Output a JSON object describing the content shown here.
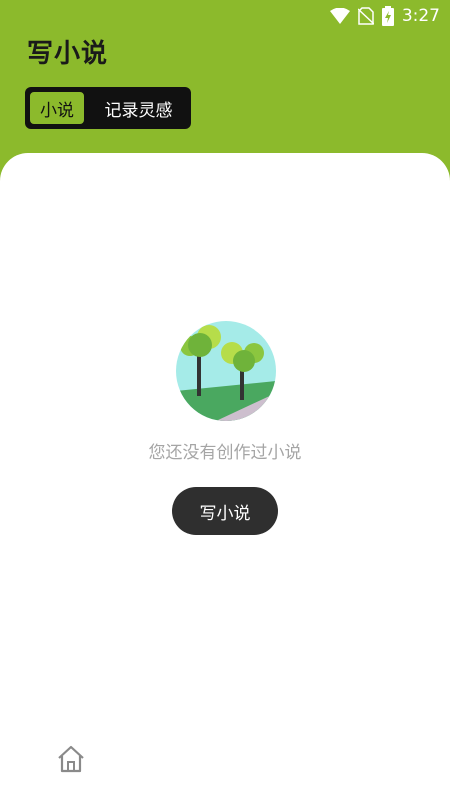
{
  "status_bar": {
    "time": "3:27",
    "icons": [
      "wifi-icon",
      "no-sim-icon",
      "battery-charging-icon"
    ]
  },
  "header": {
    "title": "写小说",
    "tabs": [
      {
        "label": "小说",
        "active": true
      },
      {
        "label": "记录灵感",
        "active": false
      }
    ],
    "accent_color": "#8cba2c"
  },
  "main": {
    "empty_illustration": "trees-illustration-icon",
    "empty_message": "您还没有创作过小说",
    "write_button_label": "写小说"
  },
  "bottom_nav": {
    "items": [
      {
        "icon": "home-icon"
      }
    ]
  }
}
